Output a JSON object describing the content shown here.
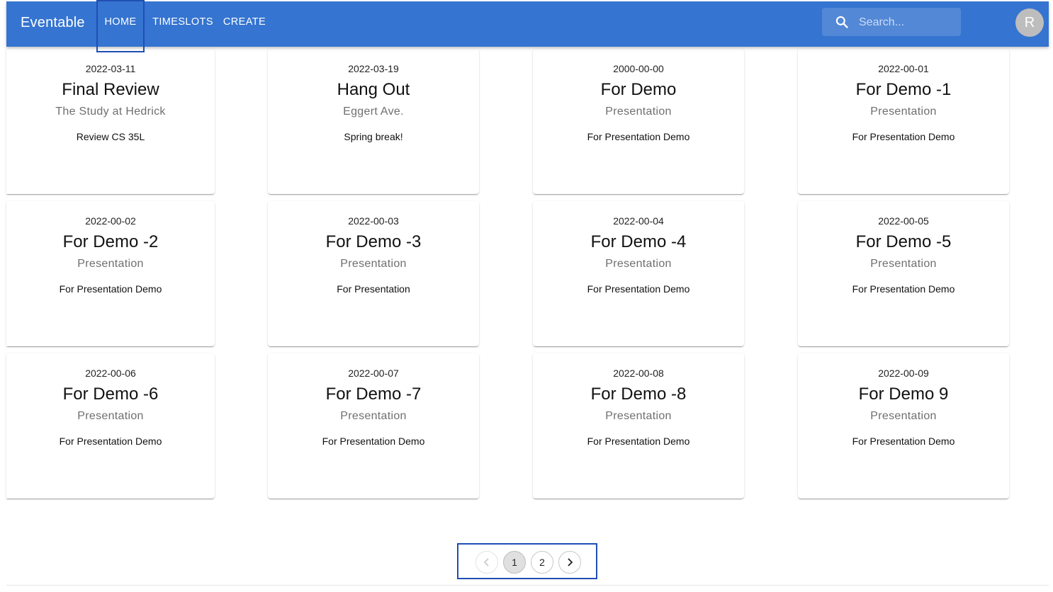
{
  "app": {
    "brand": "Eventable"
  },
  "nav": {
    "home": "HOME",
    "timeslots": "TIMESLOTS",
    "create": "CREATE"
  },
  "search": {
    "placeholder": "Search..."
  },
  "avatar": {
    "initial": "R"
  },
  "colors": {
    "appbar": "#3574d0",
    "highlight_border": "#1f4fb4",
    "avatar": "#bdbdbd"
  },
  "cards": [
    {
      "date": "2022-03-11",
      "title": "Final Review",
      "subtitle": "The Study at Hedrick",
      "description": "Review CS 35L"
    },
    {
      "date": "2022-03-19",
      "title": "Hang Out",
      "subtitle": "Eggert Ave.",
      "description": "Spring break!"
    },
    {
      "date": "2000-00-00",
      "title": "For Demo",
      "subtitle": "Presentation",
      "description": "For Presentation Demo"
    },
    {
      "date": "2022-00-01",
      "title": "For Demo -1",
      "subtitle": "Presentation",
      "description": "For Presentation Demo"
    },
    {
      "date": "2022-00-02",
      "title": "For Demo -2",
      "subtitle": "Presentation",
      "description": "For Presentation Demo"
    },
    {
      "date": "2022-00-03",
      "title": "For Demo -3",
      "subtitle": "Presentation",
      "description": "For Presentation"
    },
    {
      "date": "2022-00-04",
      "title": "For Demo -4",
      "subtitle": "Presentation",
      "description": "For Presentation Demo"
    },
    {
      "date": "2022-00-05",
      "title": "For Demo -5",
      "subtitle": "Presentation",
      "description": "For Presentation Demo"
    },
    {
      "date": "2022-00-06",
      "title": "For Demo -6",
      "subtitle": "Presentation",
      "description": "For Presentation Demo"
    },
    {
      "date": "2022-00-07",
      "title": "For Demo -7",
      "subtitle": "Presentation",
      "description": "For Presentation Demo"
    },
    {
      "date": "2022-00-08",
      "title": "For Demo -8",
      "subtitle": "Presentation",
      "description": "For Presentation Demo"
    },
    {
      "date": "2022-00-09",
      "title": "For Demo 9",
      "subtitle": "Presentation",
      "description": "For Presentation Demo"
    }
  ],
  "pagination": {
    "pages": [
      "1",
      "2"
    ],
    "current": "1",
    "prev_icon": "chevron-left-icon",
    "next_icon": "chevron-right-icon"
  }
}
